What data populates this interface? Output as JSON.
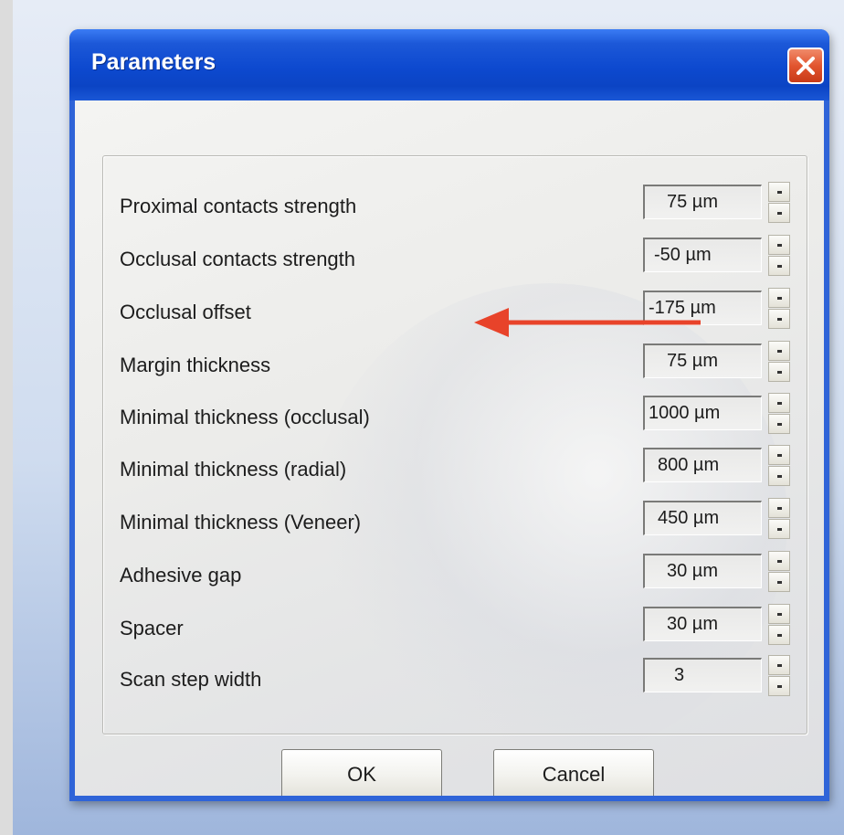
{
  "window": {
    "title": "Parameters"
  },
  "parameters": [
    {
      "label": "Proximal contacts strength",
      "value": "75 µm"
    },
    {
      "label": "Occlusal contacts strength",
      "value": "-50 µm"
    },
    {
      "label": "Occlusal offset",
      "value": "-175 µm"
    },
    {
      "label": "Margin thickness",
      "value": "75 µm"
    },
    {
      "label": "Minimal thickness (occlusal)",
      "value": "1000 µm"
    },
    {
      "label": "Minimal thickness (radial)",
      "value": "800 µm"
    },
    {
      "label": "Minimal thickness (Veneer)",
      "value": "450 µm"
    },
    {
      "label": "Adhesive gap",
      "value": "30 µm"
    },
    {
      "label": "Spacer",
      "value": "30 µm"
    },
    {
      "label": "Scan step width",
      "value": "3"
    }
  ],
  "buttons": {
    "ok": "OK",
    "cancel": "Cancel"
  },
  "colors": {
    "titlebar": "#0b44c4",
    "annotation_arrow": "#e8432a",
    "close_button": "#e2552f"
  },
  "icons": {
    "close": "close-icon",
    "annotation": "arrow-left-icon"
  }
}
